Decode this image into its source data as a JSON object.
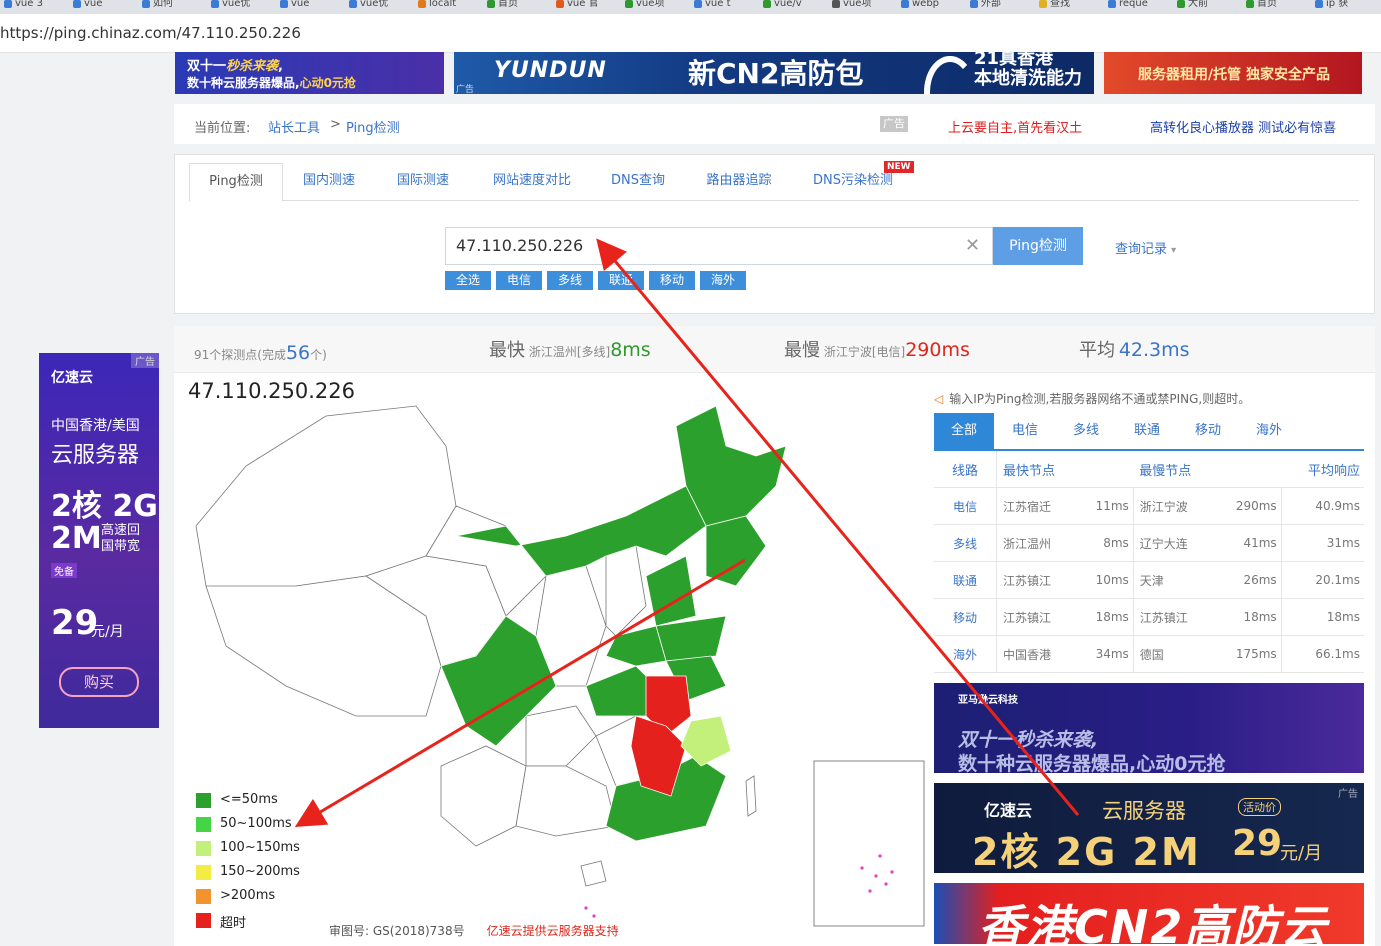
{
  "browser": {
    "bookmarks": [
      "vue 3",
      "vue",
      "如何",
      "vue优",
      "vue",
      "vue优",
      "localt",
      "首页",
      "vue 官",
      "vue项",
      "vue t",
      "vue/v",
      "vue项",
      "webp",
      "外部",
      "查找",
      "reque",
      "大前",
      "首页",
      "ip 获"
    ],
    "url": "https://ping.chinaz.com/47.110.250.226"
  },
  "banners": {
    "b1_line1_plain": "双十一",
    "b1_line1_italic": "秒杀来袭",
    "b1_line1_tail": ",",
    "b1_line2_plain": "数十种云服务器爆品,",
    "b1_line2_accent": "心动0元抢",
    "b2_brand": "YUNDUN",
    "b2_ad": "广告",
    "b2_mid": "新CN2高防包",
    "b2_r1": "21真香港",
    "b2_r2": "本地清洗能力",
    "b3_text": "服务器租用/托管  独家安全产品"
  },
  "breadcrumb": {
    "prefix": "当前位置:",
    "item1": "站长工具",
    "sep": ">",
    "item2": "Ping检测",
    "ad_tag": "广告",
    "red_link": "上云要自主,首先看汉土",
    "blue_link": "高转化良心播放器 测试必有惊喜"
  },
  "tabs": [
    {
      "label": "Ping检测",
      "active": true
    },
    {
      "label": "国内测速"
    },
    {
      "label": "国际测速"
    },
    {
      "label": "网站速度对比"
    },
    {
      "label": "DNS查询"
    },
    {
      "label": "路由器追踪"
    },
    {
      "label": "DNS污染检测"
    }
  ],
  "new_badge": "NEW",
  "search": {
    "value": "47.110.250.226",
    "clear_icon": "✕",
    "button": "Ping检测",
    "history": "查询记录",
    "history_icon": "▾"
  },
  "chips": [
    "全选",
    "电信",
    "多线",
    "联通",
    "移动",
    "海外"
  ],
  "stats": {
    "probes_prefix": "91个探测点(完成",
    "probes_done": "56",
    "probes_suffix": "个)",
    "fastest_label": "最快",
    "fastest_node": "浙江温州[多线]",
    "fastest_value": "8ms",
    "slowest_label": "最慢",
    "slowest_node": "浙江宁波[电信]",
    "slowest_value": "290ms",
    "avg_label": "平均",
    "avg_value": "42.3ms"
  },
  "map": {
    "title": "47.110.250.226",
    "legend": [
      {
        "label": "<=50ms",
        "color": "#2ca02c"
      },
      {
        "label": "50~100ms",
        "color": "#45d445"
      },
      {
        "label": "100~150ms",
        "color": "#c3f07a"
      },
      {
        "label": "150~200ms",
        "color": "#f3ec43"
      },
      {
        "label": ">200ms",
        "color": "#f29330"
      },
      {
        "label": "超时",
        "color": "#e4211c"
      }
    ],
    "footer_approval": "审图号: GS(2018)738号",
    "footer_sponsor": "亿速云提供云服务器支持"
  },
  "side": {
    "notice_icon": "speaker-icon",
    "notice": "输入IP为Ping检测,若服务器网络不通或禁PING,则超时。",
    "isp_tabs": [
      "全部",
      "电信",
      "多线",
      "联通",
      "移动",
      "海外"
    ],
    "headers": [
      "线路",
      "最快节点",
      "最慢节点",
      "平均响应"
    ],
    "rows": [
      {
        "isp": "电信",
        "fast_node": "江苏宿迁",
        "fast_ms": "11ms",
        "slow_node": "浙江宁波",
        "slow_ms": "290ms",
        "avg": "40.9ms"
      },
      {
        "isp": "多线",
        "fast_node": "浙江温州",
        "fast_ms": "8ms",
        "slow_node": "辽宁大连",
        "slow_ms": "41ms",
        "avg": "31ms"
      },
      {
        "isp": "联通",
        "fast_node": "江苏镇江",
        "fast_ms": "10ms",
        "slow_node": "天津",
        "slow_ms": "26ms",
        "avg": "20.1ms"
      },
      {
        "isp": "移动",
        "fast_node": "江苏镇江",
        "fast_ms": "18ms",
        "slow_node": "江苏镇江",
        "slow_ms": "18ms",
        "avg": "18ms"
      },
      {
        "isp": "海外",
        "fast_node": "中国香港",
        "fast_ms": "34ms",
        "slow_node": "德国",
        "slow_ms": "175ms",
        "avg": "66.1ms"
      }
    ]
  },
  "right_ads": {
    "ad1_company": "亚马逊云科技",
    "ad1_line1": "双十一秒杀来袭,",
    "ad1_line2": "数十种云服务器爆品,心动0元抢",
    "ad2_logo": "亿速云",
    "ad2_service": "云服务器",
    "ad2_tag": "活动价",
    "ad2_spec": "2核 2G 2M",
    "ad2_price": "29",
    "ad2_unit": "元/月",
    "ad2_ad": "广告",
    "ad3_text": "香港CN2高防云"
  },
  "left_ad": {
    "ad_tag": "广告",
    "logo": "亿速云",
    "region": "中国香港/美国",
    "service": "云服务器",
    "core": "2核 2G",
    "mb": "2M",
    "bw1": "高速回",
    "bw2": "国带宽",
    "free": "免备",
    "price": "29",
    "unit": "元/月",
    "buy": "购买"
  }
}
